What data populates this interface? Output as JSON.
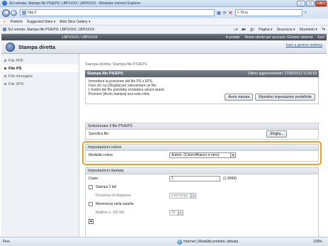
{
  "browser": {
    "title": "SU remota: Stampa file PS/EPS: LBPXXXX: LBPXXXX - Windows Internet Explorer",
    "url": "http://",
    "search_placeholder": "Bing",
    "favorites_label": "Preferiti",
    "fav_links": [
      "Suggested Sites ▾",
      "Web Slice Gallery ▾"
    ],
    "tab_title": "SU remota: Stampa file PS/EPS: LBPXXXX: LBPXXXX",
    "tools": [
      "Pagina ▾",
      "Sicurezza ▾",
      "Strumenti ▾"
    ],
    "status_left": "Fine",
    "status_zone": "Internet | Modalità protetta: attivata",
    "zoom": "100%"
  },
  "topnav": {
    "printer": "LBPXXXX / LBPXXXX",
    "links": [
      "A portale",
      "Nome utente per accesso: Gestore sistema",
      "Esci"
    ]
  },
  "header": {
    "title": "Stampa diretta",
    "to_management": "Invio a gestore sistema"
  },
  "sidebar": {
    "items": [
      {
        "label": "File PDF",
        "active": false
      },
      {
        "label": "File PS",
        "active": true
      },
      {
        "label": "File immagine",
        "active": false
      },
      {
        "label": "File XPS",
        "active": false
      }
    ]
  },
  "main": {
    "breadcrumb": "Stampa diretta: Stampa file PS/EPS",
    "panel_title": "Stampa file PS/EPS",
    "last_update": "Ultimo aggiornamento: 17/05/2012 11:05:10",
    "intro_lines": [
      "Immettere la posizione del file PS o EPS.",
      "Fare clic su [Sfoglia] per selezionare un file.",
      "L'inoltro del file potrebbe richiedere alcuni istanti.",
      "Premere [Avvio stampa] una sola volta."
    ],
    "start_print_button": "Avvio stampa",
    "reset_button": "Ripristino impostazioni predefinite",
    "file_section": {
      "title": "Selezionare il file PS/EPS",
      "label": "Specifica file:",
      "browse_button": "Sfoglia..."
    },
    "color_section": {
      "title": "Impostazioni colore",
      "label": "Modalità colore:",
      "value": "Autom. (Colore/Bianco e nero)"
    },
    "print_section": {
      "title": "Impostazioni stampa",
      "copies_label": "Copie:",
      "copies_value": "1",
      "copies_range": "(1-9999)",
      "duplex_label": "Stampa 2 lati",
      "binding_label": "Posizione di rilegatura:",
      "binding_value": "Lato lungo",
      "mailbox_label": "Memorizza nella casella",
      "mailbox_no_label": "Mailbox n. (00-99):",
      "mailbox_no_value": "00"
    }
  }
}
